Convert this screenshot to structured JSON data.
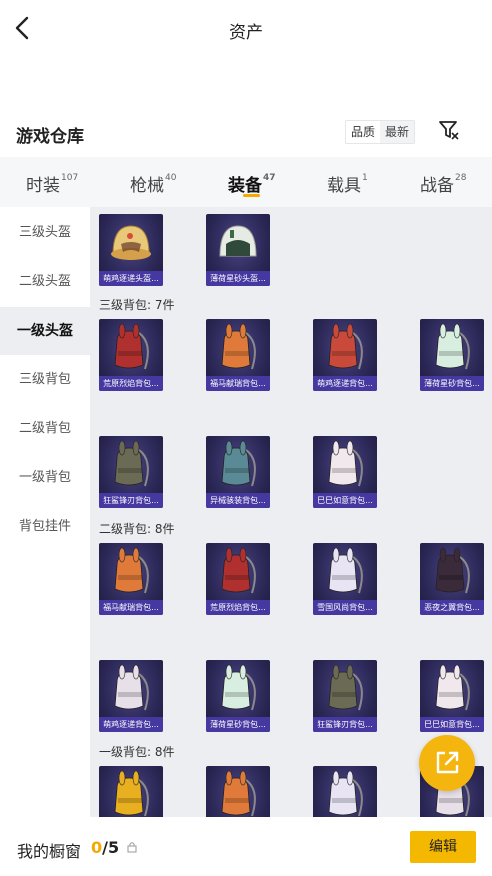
{
  "header": {
    "title": "资产"
  },
  "warehouse": {
    "title": "游戏仓库",
    "sort_options": [
      {
        "label": "品质",
        "active": false
      },
      {
        "label": "最新",
        "active": true
      }
    ]
  },
  "tabs": [
    {
      "label": "时装",
      "count": "107",
      "active": false
    },
    {
      "label": "枪械",
      "count": "40",
      "active": false
    },
    {
      "label": "装备",
      "count": "47",
      "active": true
    },
    {
      "label": "载具",
      "count": "1",
      "active": false
    },
    {
      "label": "战备",
      "count": "28",
      "active": false
    }
  ],
  "sidebar": {
    "items": [
      {
        "label": "三级头盔",
        "active": false
      },
      {
        "label": "二级头盔",
        "active": false
      },
      {
        "label": "一级头盔",
        "active": true
      },
      {
        "label": "三级背包",
        "active": false
      },
      {
        "label": "二级背包",
        "active": false
      },
      {
        "label": "一级背包",
        "active": false
      },
      {
        "label": "背包挂件",
        "active": false
      }
    ]
  },
  "helmets": [
    {
      "name": "萌鸡逐递头盔...",
      "icon": "chick-helmet-icon",
      "color": "#e8c97a"
    },
    {
      "name": "薄荷星砂头盔...",
      "icon": "mint-helmet-icon",
      "color": "#e6ebe4"
    }
  ],
  "sections": [
    {
      "title": "三级背包: 7件",
      "items": [
        {
          "name": "荒原烈焰背包...",
          "icon": "flame-backpack-icon",
          "color": "#b03030"
        },
        {
          "name": "福马献瑞背包...",
          "icon": "horse-backpack-icon",
          "color": "#e07a3a"
        },
        {
          "name": "萌鸡逐递背包...",
          "icon": "chick-backpack-icon",
          "color": "#c94a3a"
        },
        {
          "name": "薄荷星砂背包...",
          "icon": "mint-backpack-icon",
          "color": "#d8eee0"
        },
        {
          "name": "狂鲨锋刃背包...",
          "icon": "shark-backpack-icon",
          "color": "#6a6a55"
        },
        {
          "name": "异械骇装背包...",
          "icon": "mech-backpack-icon",
          "color": "#5a8a95"
        },
        {
          "name": "巳巳如意背包...",
          "icon": "snake-backpack-icon",
          "color": "#f0e8ec"
        }
      ]
    },
    {
      "title": "二级背包: 8件",
      "items": [
        {
          "name": "福马献瑞背包...",
          "icon": "horse-backpack-icon",
          "color": "#e07a3a"
        },
        {
          "name": "荒原烈焰背包...",
          "icon": "flame-backpack-icon",
          "color": "#b03030"
        },
        {
          "name": "雪国风尚背包...",
          "icon": "snow-backpack-icon",
          "color": "#e8e4f4"
        },
        {
          "name": "恶夜之翼背包...",
          "icon": "nightwing-backpack-icon",
          "color": "#3a2a3a"
        },
        {
          "name": "萌鸡逐递背包...",
          "icon": "chick-backpack-icon",
          "color": "#e8e0e8"
        },
        {
          "name": "薄荷星砂背包...",
          "icon": "mint-backpack-icon",
          "color": "#d8eee0"
        },
        {
          "name": "狂鲨锋刃背包...",
          "icon": "shark-backpack-icon",
          "color": "#6a6a55"
        },
        {
          "name": "巳巳如意背包...",
          "icon": "snake-backpack-icon",
          "color": "#f0e8ec"
        }
      ]
    },
    {
      "title": "一级背包: 8件",
      "items": [
        {
          "name": "",
          "icon": "pineapple-backpack-icon",
          "color": "#e8b020"
        },
        {
          "name": "",
          "icon": "horse-backpack-icon",
          "color": "#e07a3a"
        },
        {
          "name": "",
          "icon": "rabbit-backpack-icon",
          "color": "#e8e4f4"
        },
        {
          "name": "",
          "icon": "chick-backpack-icon",
          "color": "#e8e0e8"
        }
      ]
    }
  ],
  "showcase": {
    "label": "我的橱窗",
    "current": "0",
    "total": "/5"
  },
  "actions": {
    "edit_label": "编辑",
    "share_icon": "share-out-icon"
  },
  "colors": {
    "accent": "#f5b800",
    "item_bg": "#2e2a5a",
    "item_label_bg": "#4538a0"
  }
}
